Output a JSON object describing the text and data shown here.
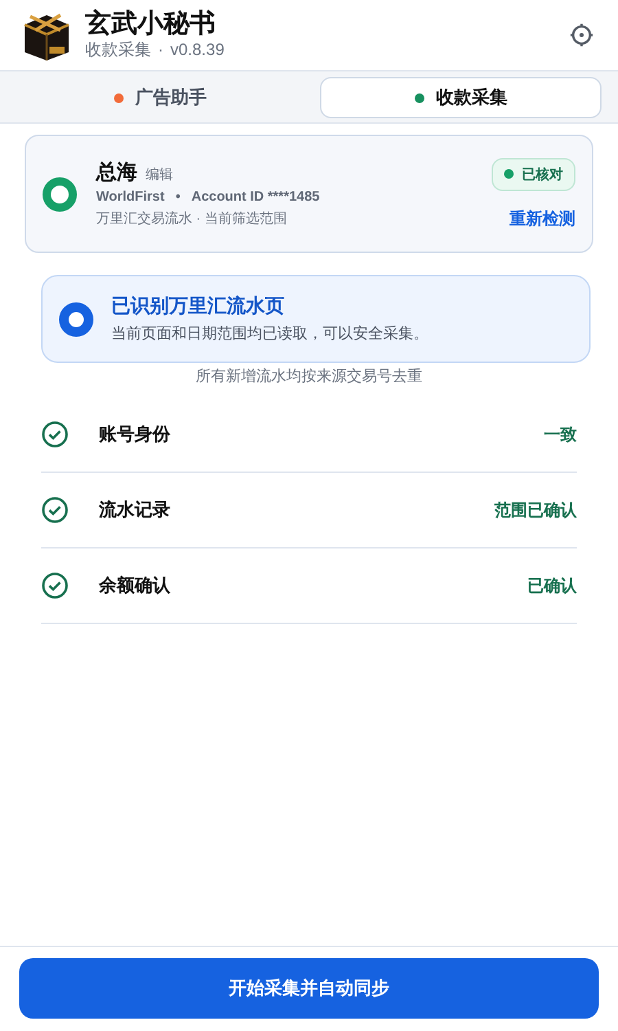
{
  "app": {
    "title": "玄武小秘书",
    "subtitle": "收款采集",
    "separator": "·",
    "version": "v0.8.39"
  },
  "tabs": [
    {
      "label": "广告助手",
      "selected": false,
      "color": "#f26b3a"
    },
    {
      "label": "收款采集",
      "selected": true,
      "color": "#17905f"
    }
  ],
  "account": {
    "name": "总海",
    "edit_link": "编辑",
    "provider": "WorldFirst",
    "separator": "•",
    "account_id": "Account ID ****1485",
    "caption": "万里汇交易流水 · 当前筛选范围",
    "badge": "已核对",
    "verified": true,
    "recheck_link": "重新检测"
  },
  "notice": {
    "title": "已识别万里汇流水页",
    "text": "当前页面和日期范围均已读取，可以安全采集。"
  },
  "dedupe_note": "所有新增流水均按来源交易号去重",
  "checks": [
    {
      "label": "账号身份",
      "status": "一致",
      "passed": true
    },
    {
      "label": "流水记录",
      "status": "范围已确认",
      "passed": true
    },
    {
      "label": "余额确认",
      "status": "已确认",
      "passed": true
    }
  ],
  "primary_button": "开始采集并自动同步"
}
